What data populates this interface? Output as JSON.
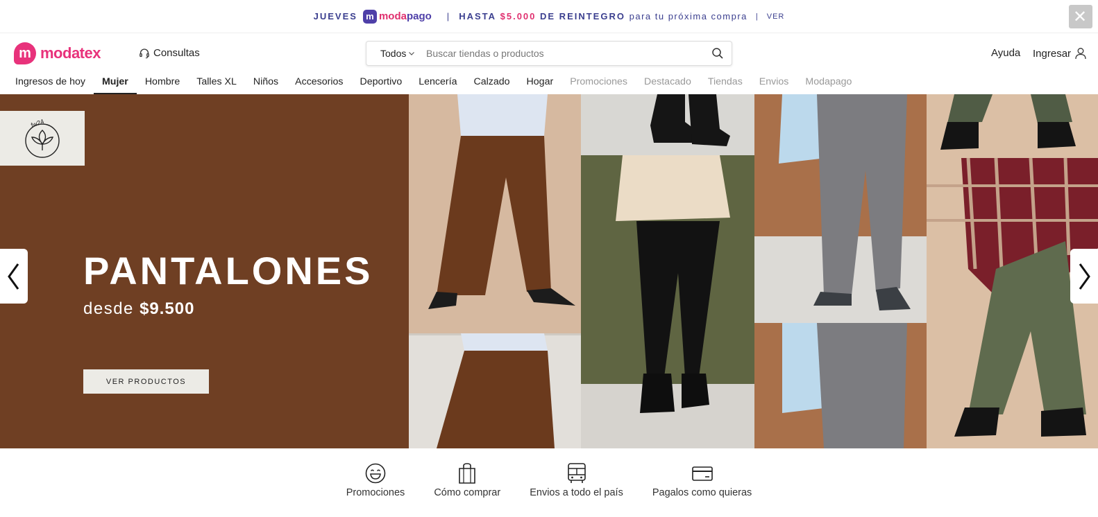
{
  "promo": {
    "day": "JUEVES",
    "brand_a": "moda",
    "brand_b": "pago",
    "brand_mark": "m",
    "separator": "|",
    "offer_prefix": "HASTA",
    "offer_amount": "$5.000",
    "offer_rest": "DE REINTEGRO",
    "offer_tail": "para tu próxima compra",
    "link_sep": "|",
    "link": "VER",
    "close_icon": "close-icon",
    "close_glyph": "✕"
  },
  "header": {
    "logo_mark": "m",
    "logo_text": "modatex",
    "consultas": "Consultas",
    "search_category": "Todos",
    "search_placeholder": "Buscar tiendas o productos",
    "help": "Ayuda",
    "login": "Ingresar"
  },
  "nav": {
    "items": [
      {
        "label": "Ingresos de hoy",
        "state": "normal"
      },
      {
        "label": "Mujer",
        "state": "active"
      },
      {
        "label": "Hombre",
        "state": "normal"
      },
      {
        "label": "Talles XL",
        "state": "normal"
      },
      {
        "label": "Niños",
        "state": "normal"
      },
      {
        "label": "Accesorios",
        "state": "normal"
      },
      {
        "label": "Deportivo",
        "state": "normal"
      },
      {
        "label": "Lencería",
        "state": "normal"
      },
      {
        "label": "Calzado",
        "state": "normal"
      },
      {
        "label": "Hogar",
        "state": "normal"
      },
      {
        "label": "Promociones",
        "state": "muted"
      },
      {
        "label": "Destacado",
        "state": "muted"
      },
      {
        "label": "Tiendas",
        "state": "muted"
      },
      {
        "label": "Envios",
        "state": "muted"
      },
      {
        "label": "Modapago",
        "state": "muted"
      }
    ]
  },
  "hero": {
    "badge_text": "fw24",
    "title": "PANTALONES",
    "subtitle_prefix": "desde",
    "subtitle_price": "$9.500",
    "cta": "VER PRODUCTOS",
    "prev_icon": "chevron-left-icon",
    "next_icon": "chevron-right-icon"
  },
  "features": [
    {
      "label": "Promociones",
      "icon": "smiley-icon"
    },
    {
      "label": "Cómo comprar",
      "icon": "shopping-bag-icon"
    },
    {
      "label": "Envios a todo el país",
      "icon": "bus-icon"
    },
    {
      "label": "Pagalos como quieras",
      "icon": "credit-card-icon"
    }
  ],
  "colors": {
    "brand": "#e8327b",
    "promo_text": "#3b3f8f",
    "hero_bg": "#6f3f23"
  }
}
